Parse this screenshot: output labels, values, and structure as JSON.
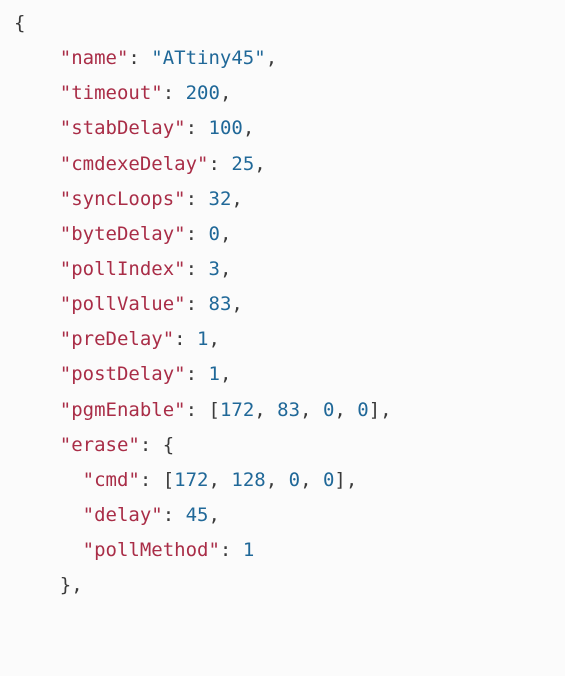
{
  "code": {
    "open_brace": "{",
    "close_brace_erase": "},",
    "entries": [
      {
        "key": "\"name\"",
        "value": "\"ATtiny45\"",
        "type": "str",
        "comma": true
      },
      {
        "key": "\"timeout\"",
        "value": "200",
        "type": "num",
        "comma": true
      },
      {
        "key": "\"stabDelay\"",
        "value": "100",
        "type": "num",
        "comma": true
      },
      {
        "key": "\"cmdexeDelay\"",
        "value": "25",
        "type": "num",
        "comma": true
      },
      {
        "key": "\"syncLoops\"",
        "value": "32",
        "type": "num",
        "comma": true
      },
      {
        "key": "\"byteDelay\"",
        "value": "0",
        "type": "num",
        "comma": true
      },
      {
        "key": "\"pollIndex\"",
        "value": "3",
        "type": "num",
        "comma": true
      },
      {
        "key": "\"pollValue\"",
        "value": "83",
        "type": "num",
        "comma": true
      },
      {
        "key": "\"preDelay\"",
        "value": "1",
        "type": "num",
        "comma": true
      },
      {
        "key": "\"postDelay\"",
        "value": "1",
        "type": "num",
        "comma": true
      }
    ],
    "pgmEnable": {
      "key": "\"pgmEnable\"",
      "values": [
        "172",
        "83",
        "0",
        "0"
      ]
    },
    "erase": {
      "key": "\"erase\"",
      "cmd_key": "\"cmd\"",
      "cmd_values": [
        "172",
        "128",
        "0",
        "0"
      ],
      "delay_key": "\"delay\"",
      "delay_value": "45",
      "pollMethod_key": "\"pollMethod\"",
      "pollMethod_value": "1"
    }
  }
}
